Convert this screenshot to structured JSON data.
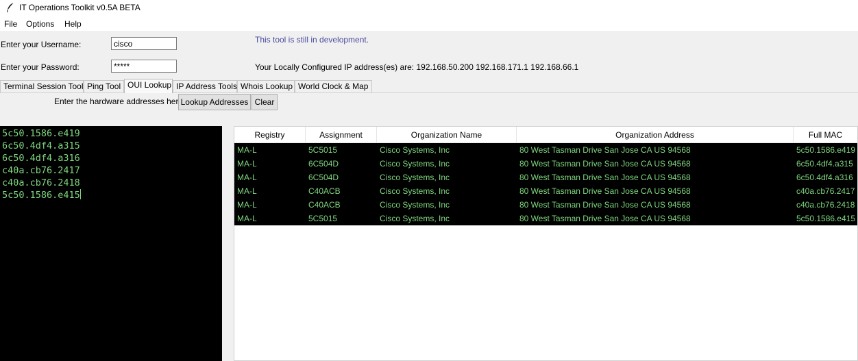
{
  "window": {
    "title": "IT Operations Toolkit v0.5A BETA",
    "icon": "feather-icon"
  },
  "menu": {
    "items": [
      "File",
      "Options",
      "Help"
    ]
  },
  "form": {
    "username_label": "Enter your Username:",
    "username_value": "cisco",
    "password_label": "Enter your Password:",
    "password_value": "*****",
    "dev_note": "This tool is still in development.",
    "ip_text": "Your Locally Configured IP address(es) are: 192.168.50.200 192.168.171.1 192.168.66.1"
  },
  "tabs": [
    {
      "label": "Terminal Session Tool"
    },
    {
      "label": "Ping Tool"
    },
    {
      "label": "OUI Lookup",
      "active": true
    },
    {
      "label": "IP Address Tools"
    },
    {
      "label": "Whois Lookup"
    },
    {
      "label": "World Clock & Map"
    }
  ],
  "oui": {
    "prompt": "Enter the hardware addresses here:",
    "lookup_button": "Lookup Addresses",
    "clear_button": "Clear",
    "input_lines": [
      "5c50.1586.e419",
      "6c50.4df4.a315",
      "6c50.4df4.a316",
      "c40a.cb76.2417",
      "c40a.cb76.2418",
      "5c50.1586.e415"
    ]
  },
  "table": {
    "columns": [
      "Registry",
      "Assignment",
      "Organization Name",
      "Organization Address",
      "Full MAC"
    ],
    "rows": [
      [
        "MA-L",
        "5C5015",
        "Cisco Systems, Inc",
        "80 West Tasman Drive San Jose CA US 94568",
        "5c50.1586.e419"
      ],
      [
        "MA-L",
        "6C504D",
        "Cisco Systems, Inc",
        "80 West Tasman Drive San Jose CA US 94568",
        "6c50.4df4.a315"
      ],
      [
        "MA-L",
        "6C504D",
        "Cisco Systems, Inc",
        "80 West Tasman Drive San Jose CA US 94568",
        "6c50.4df4.a316"
      ],
      [
        "MA-L",
        "C40ACB",
        "Cisco Systems, Inc",
        "80 West Tasman Drive San Jose CA US 94568",
        "c40a.cb76.2417"
      ],
      [
        "MA-L",
        "C40ACB",
        "Cisco Systems, Inc",
        "80 West Tasman Drive San Jose CA US 94568",
        "c40a.cb76.2418"
      ],
      [
        "MA-L",
        "5C5015",
        "Cisco Systems, Inc",
        "80 West Tasman Drive San Jose CA US 94568",
        "5c50.1586.e415"
      ]
    ]
  },
  "colors": {
    "terminal_bg": "#000000",
    "terminal_fg": "#7fd67f",
    "dev_note": "#4a4a9e"
  }
}
